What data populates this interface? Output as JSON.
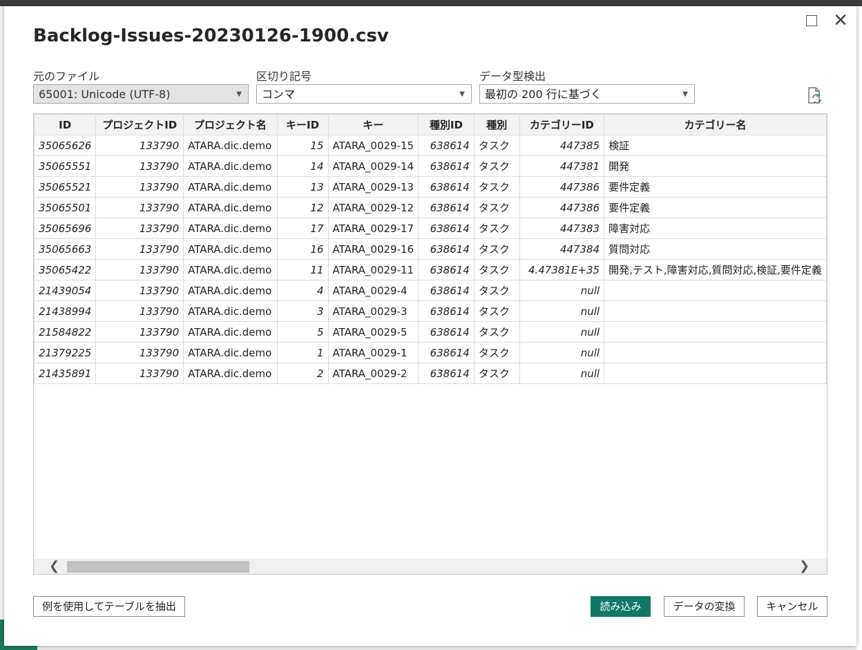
{
  "dialog": {
    "title": "Backlog-Issues-20230126-1900.csv",
    "maximize_icon": "maximize-icon",
    "close_icon": "close-icon",
    "close_glyph": "✕"
  },
  "file_origin": {
    "label": "元のファイル",
    "value": "65001: Unicode (UTF-8)"
  },
  "delimiter": {
    "label": "区切り記号",
    "value": "コンマ"
  },
  "type_detection": {
    "label": "データ型検出",
    "value": "最初の 200 行に基づく"
  },
  "table": {
    "columns": [
      "ID",
      "プロジェクトID",
      "プロジェクト名",
      "キーID",
      "キー",
      "種別ID",
      "種別",
      "カテゴリーID",
      "カテゴリー名"
    ],
    "rows": [
      [
        "35065626",
        "133790",
        "ATARA.dic.demo",
        "15",
        "ATARA_0029-15",
        "638614",
        "タスク",
        "447385",
        "検証"
      ],
      [
        "35065551",
        "133790",
        "ATARA.dic.demo",
        "14",
        "ATARA_0029-14",
        "638614",
        "タスク",
        "447381",
        "開発"
      ],
      [
        "35065521",
        "133790",
        "ATARA.dic.demo",
        "13",
        "ATARA_0029-13",
        "638614",
        "タスク",
        "447386",
        "要件定義"
      ],
      [
        "35065501",
        "133790",
        "ATARA.dic.demo",
        "12",
        "ATARA_0029-12",
        "638614",
        "タスク",
        "447386",
        "要件定義"
      ],
      [
        "35065696",
        "133790",
        "ATARA.dic.demo",
        "17",
        "ATARA_0029-17",
        "638614",
        "タスク",
        "447383",
        "障害対応"
      ],
      [
        "35065663",
        "133790",
        "ATARA.dic.demo",
        "16",
        "ATARA_0029-16",
        "638614",
        "タスク",
        "447384",
        "質問対応"
      ],
      [
        "35065422",
        "133790",
        "ATARA.dic.demo",
        "11",
        "ATARA_0029-11",
        "638614",
        "タスク",
        "4.47381E+35",
        "開発,テスト,障害対応,質問対応,検証,要件定義"
      ],
      [
        "21439054",
        "133790",
        "ATARA.dic.demo",
        "4",
        "ATARA_0029-4",
        "638614",
        "タスク",
        "null",
        ""
      ],
      [
        "21438994",
        "133790",
        "ATARA.dic.demo",
        "3",
        "ATARA_0029-3",
        "638614",
        "タスク",
        "null",
        ""
      ],
      [
        "21584822",
        "133790",
        "ATARA.dic.demo",
        "5",
        "ATARA_0029-5",
        "638614",
        "タスク",
        "null",
        ""
      ],
      [
        "21379225",
        "133790",
        "ATARA.dic.demo",
        "1",
        "ATARA_0029-1",
        "638614",
        "タスク",
        "null",
        ""
      ],
      [
        "21435891",
        "133790",
        "ATARA.dic.demo",
        "2",
        "ATARA_0029-2",
        "638614",
        "タスク",
        "null",
        ""
      ]
    ]
  },
  "buttons": {
    "extract": "例を使用してテーブルを抽出",
    "load": "読み込み",
    "transform": "データの変換",
    "cancel": "キャンセル"
  },
  "colors": {
    "primary": "#117865"
  }
}
